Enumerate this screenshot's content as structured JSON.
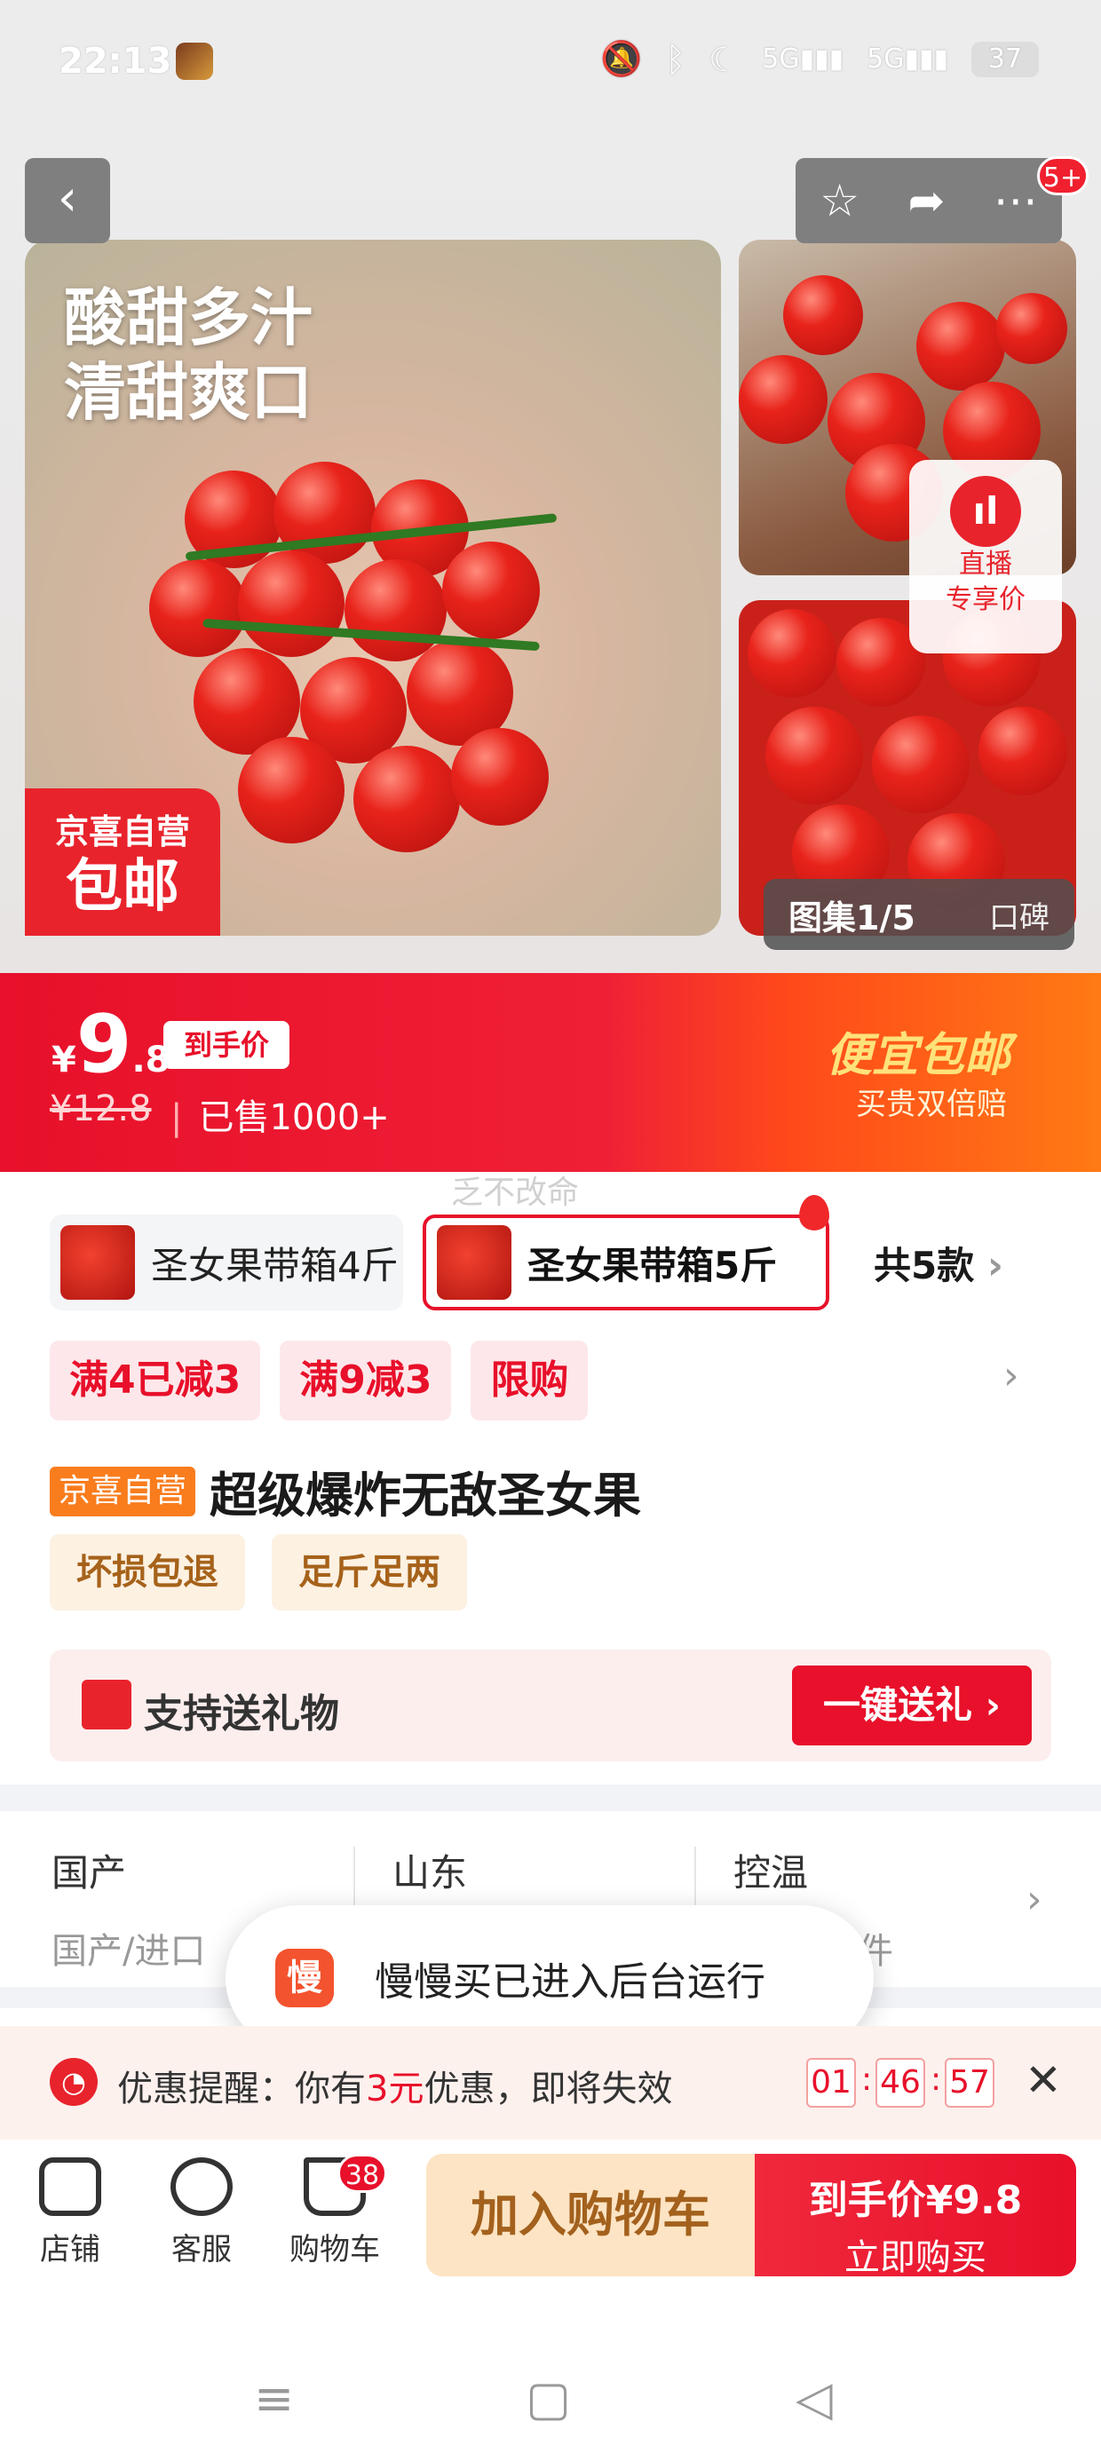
{
  "status_bar": {
    "time": "22:13",
    "network": "5G",
    "network2": "5G",
    "battery": "37"
  },
  "header": {
    "cart_badge": "5+"
  },
  "gallery": {
    "slogan_line1": "酸甜多汁",
    "slogan_line2": "清甜爽口",
    "badge_line1": "京喜自营",
    "badge_line2": "包邮",
    "live_line1": "直播",
    "live_line2": "专享价",
    "album_label": "图集1/5",
    "reviews_label": "口碑"
  },
  "price": {
    "currency": "¥",
    "integer": "9",
    "decimal": ".8",
    "final_tag": "到手价",
    "original": "¥12.8",
    "sold": "已售1000+",
    "promo_title": "便宜包邮",
    "promo_sub": "买贵双倍赔"
  },
  "watermark": "乏不改命",
  "variants": {
    "items": [
      {
        "label": "圣女果带箱4斤"
      },
      {
        "label": "圣女果带箱5斤"
      }
    ],
    "all_label": "共5款"
  },
  "coupons": [
    "满4已减3",
    "满9减3",
    "限购"
  ],
  "product": {
    "self_tag": "京喜自营",
    "title": "超级爆炸无敌圣女果",
    "service_tags": [
      "坏损包退",
      "足斤足两"
    ]
  },
  "gift": {
    "label": "支持送礼物",
    "button": "一键送礼"
  },
  "attributes": [
    {
      "key": "国产",
      "value": "国产/进口"
    },
    {
      "key": "山东",
      "value": ""
    },
    {
      "key": "控温",
      "value": "件"
    }
  ],
  "toast": {
    "icon_char": "慢",
    "text": "慢慢买已进入后台运行"
  },
  "reminder": {
    "prefix": "优惠提醒：你有",
    "amount": "3元",
    "suffix": "优惠，即将失效",
    "hours": "01",
    "minutes": "46",
    "seconds": "57"
  },
  "bottom_bar": {
    "shop": "店铺",
    "service": "客服",
    "cart": "购物车",
    "cart_count": "38",
    "add_to_cart": "加入购物车",
    "buy_price": "到手价¥9.8",
    "buy_now": "立即购买"
  },
  "colors": {
    "accent": "#e8102a",
    "brand_orange": "#f97c1d",
    "gold": "#ffe27a"
  }
}
